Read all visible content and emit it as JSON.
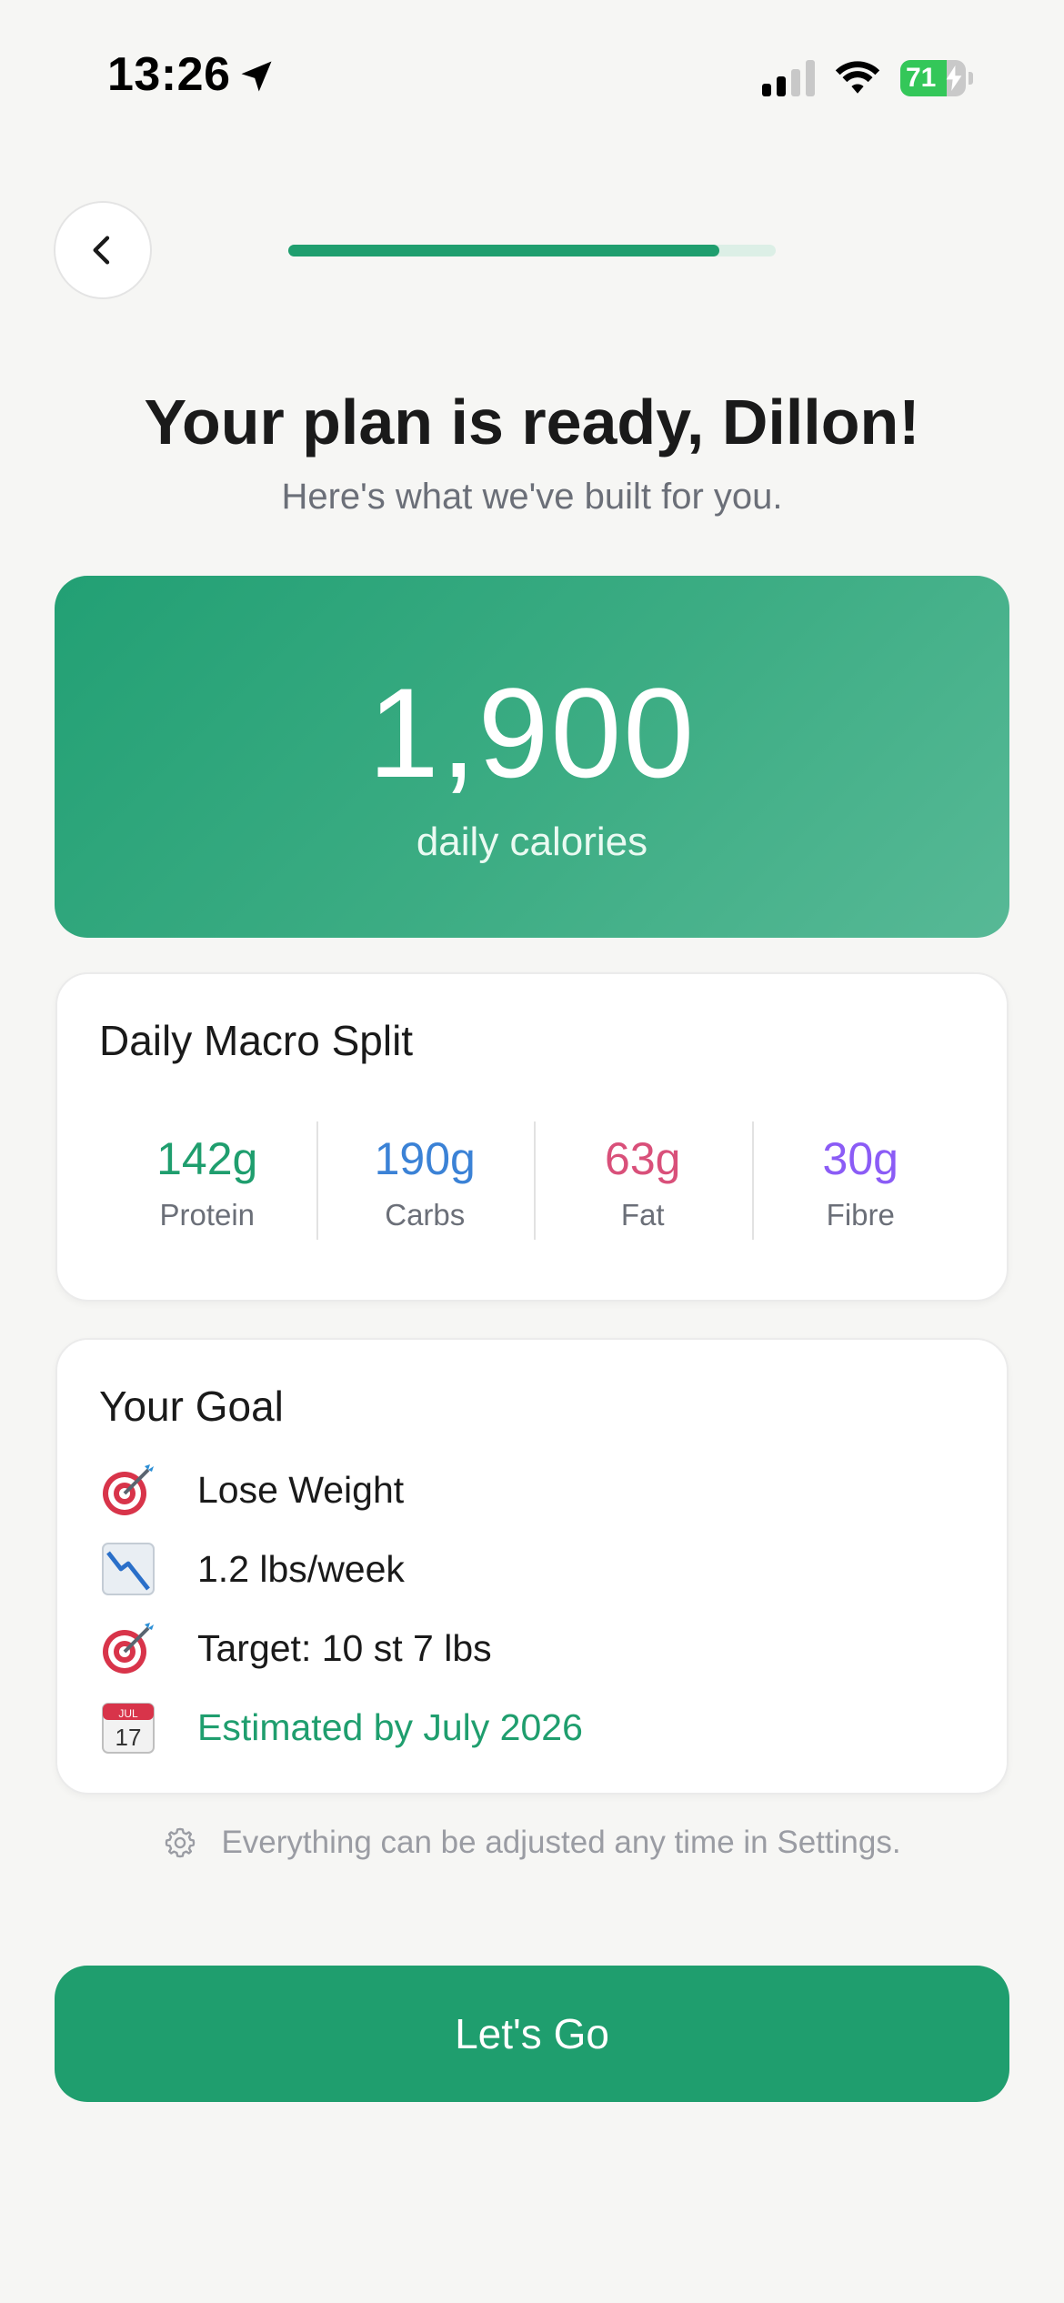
{
  "status_bar": {
    "time": "13:26",
    "battery_percent": "71",
    "battery_level": 0.71,
    "icons": [
      "location-arrow-icon",
      "cellular-signal-icon",
      "wifi-icon",
      "battery-charging-icon"
    ]
  },
  "header": {
    "back_icon": "chevron-left-icon",
    "progress": 0.885
  },
  "intro": {
    "title": "Your plan is ready, Dillon!",
    "subtitle": "Here's what we've built for you."
  },
  "calories": {
    "value": "1,900",
    "label": "daily calories"
  },
  "macros": {
    "title": "Daily Macro Split",
    "items": [
      {
        "value": "142g",
        "label": "Protein",
        "color": "#1f9e6e"
      },
      {
        "value": "190g",
        "label": "Carbs",
        "color": "#3b82d6"
      },
      {
        "value": "63g",
        "label": "Fat",
        "color": "#d9507a"
      },
      {
        "value": "30g",
        "label": "Fibre",
        "color": "#8b5cf6"
      }
    ]
  },
  "goal": {
    "title": "Your Goal",
    "items": [
      {
        "icon": "target-icon",
        "text": "Lose Weight"
      },
      {
        "icon": "chart-decreasing-icon",
        "text": "1.2 lbs/week"
      },
      {
        "icon": "target-icon",
        "text": "Target: 10 st 7 lbs"
      },
      {
        "icon": "calendar-icon",
        "text": "Estimated by July 2026",
        "calendar_month": "JUL",
        "calendar_day": "17"
      }
    ]
  },
  "footnote": {
    "icon": "gear-icon",
    "text": "Everything can be adjusted any time in Settings."
  },
  "cta": {
    "label": "Let's Go"
  },
  "colors": {
    "accent": "#1f9e6e",
    "background": "#f6f6f4"
  }
}
